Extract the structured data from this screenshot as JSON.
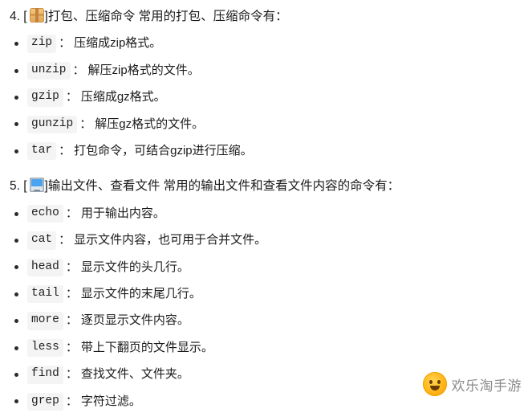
{
  "document": {
    "sections": [
      {
        "number": "4.",
        "icon": "package-emoji",
        "title_before_icon": "4. [",
        "title_after_icon": "]打包、压缩命令 常用的打包、压缩命令有：",
        "items": [
          {
            "cmd": "zip",
            "sep": "：",
            "desc": "压缩成zip格式。"
          },
          {
            "cmd": "unzip",
            "sep": "：",
            "desc": "解压zip格式的文件。"
          },
          {
            "cmd": "gzip",
            "sep": "：",
            "desc": "压缩成gz格式。"
          },
          {
            "cmd": "gunzip",
            "sep": "：",
            "desc": "解压gz格式的文件。"
          },
          {
            "cmd": "tar",
            "sep": "：",
            "desc": "打包命令，可结合gzip进行压缩。"
          }
        ]
      },
      {
        "number": "5.",
        "icon": "monitor-emoji",
        "title_before_icon": "5. [",
        "title_after_icon": "]输出文件、查看文件 常用的输出文件和查看文件内容的命令有：",
        "items": [
          {
            "cmd": "echo",
            "sep": "：",
            "desc": "用于输出内容。"
          },
          {
            "cmd": "cat",
            "sep": "：",
            "desc": "显示文件内容，也可用于合并文件。"
          },
          {
            "cmd": "head",
            "sep": "：",
            "desc": "显示文件的头几行。"
          },
          {
            "cmd": "tail",
            "sep": "：",
            "desc": "显示文件的末尾几行。"
          },
          {
            "cmd": "more",
            "sep": "：",
            "desc": "逐页显示文件内容。"
          },
          {
            "cmd": "less",
            "sep": "：",
            "desc": "带上下翻页的文件显示。"
          },
          {
            "cmd": "find",
            "sep": "：",
            "desc": "查找文件、文件夹。"
          },
          {
            "cmd": "grep",
            "sep": "：",
            "desc": "字符过滤。"
          }
        ]
      }
    ]
  },
  "watermark": {
    "text": "欢乐淘手游",
    "logo": "smiley-face-logo"
  }
}
